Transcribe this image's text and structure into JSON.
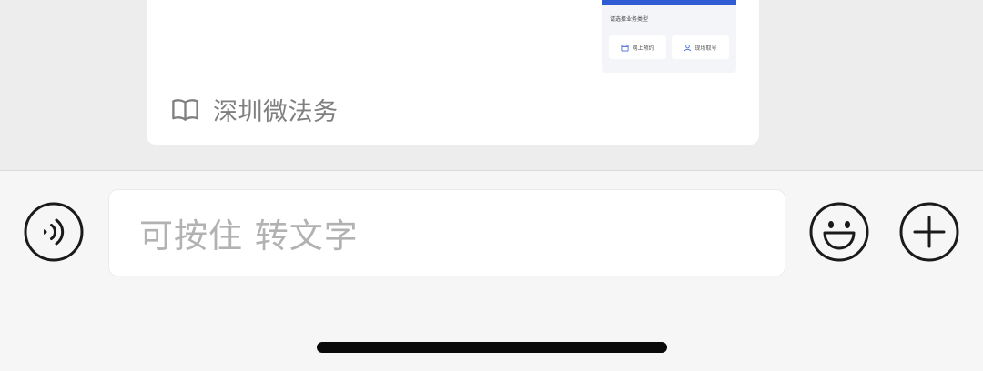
{
  "message_card": {
    "thumbnail": {
      "title": "请选择业务类型",
      "options": [
        "网上预约",
        "现场取号"
      ]
    },
    "source_name": "深圳微法务",
    "source_icon": "book-open-icon"
  },
  "input_bar": {
    "voice_icon": "voice-mode-icon",
    "placeholder": "可按住 转文字",
    "emoji_icon": "emoji-smile-icon",
    "more_icon": "plus-circle-icon"
  },
  "colors": {
    "chat_background": "#ededed",
    "toolbar_background": "#f6f6f6",
    "card_background": "#ffffff",
    "thumbnail_accent": "#2f5bd3",
    "placeholder_text": "#b2b2b2",
    "source_text": "#7f7f7f"
  }
}
